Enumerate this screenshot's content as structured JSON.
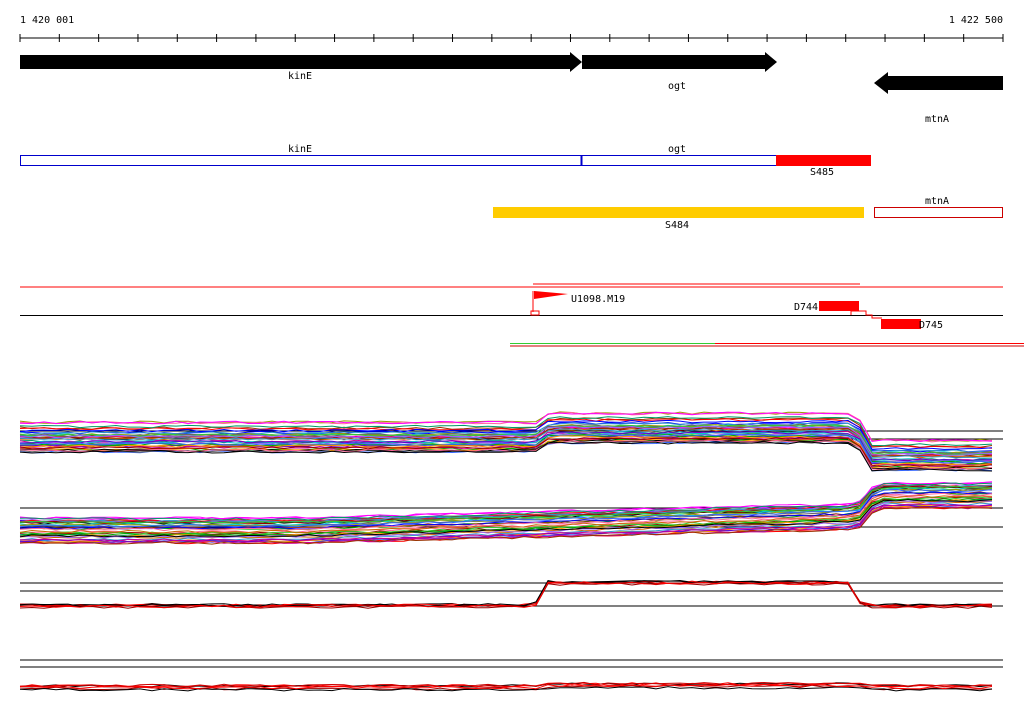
{
  "ruler": {
    "start_label": "1 420 001",
    "end_label": "1 422 500"
  },
  "genes": [
    {
      "label": "kinE",
      "strand": "+"
    },
    {
      "label": "ogt",
      "strand": "+"
    },
    {
      "label": "mtnA",
      "strand": "-"
    }
  ],
  "segments_row1": [
    {
      "label": "kinE"
    },
    {
      "label": "ogt"
    },
    {
      "label": "S485"
    }
  ],
  "segments_row2": [
    {
      "label": "S484"
    },
    {
      "label": "mtnA"
    }
  ],
  "features": {
    "u_label": "U1098.M19",
    "d744_label": "D744",
    "d745_label": "D745"
  },
  "colors": {
    "gene_arrow": "#000000",
    "outline_blue": "#0000cc",
    "highlight_red": "#ff0000",
    "highlight_yellow": "#ffcc00",
    "green_track": "#33cc33"
  }
}
